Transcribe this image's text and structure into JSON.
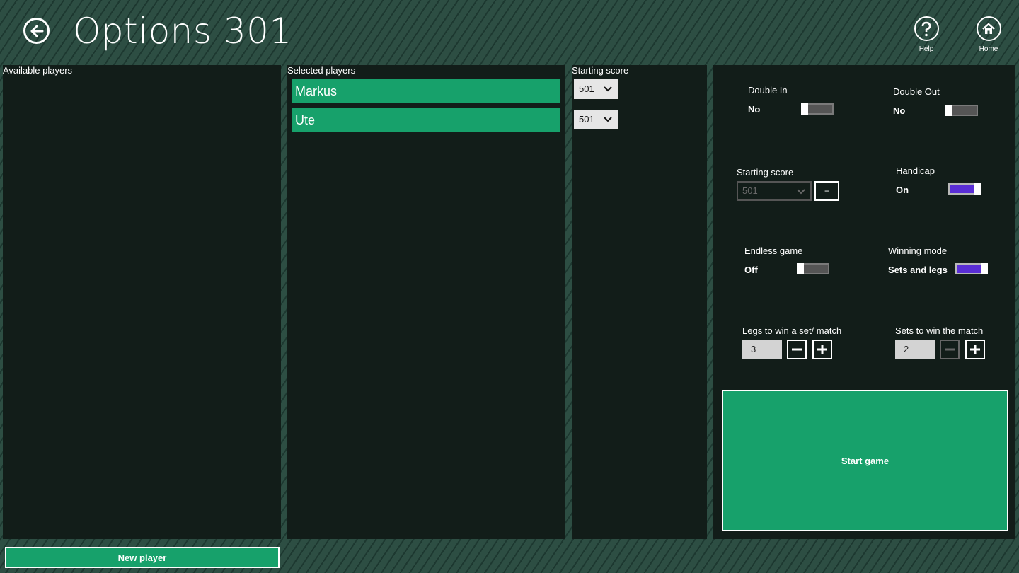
{
  "header": {
    "title": "Options 301",
    "back_icon": "arrow-left-icon",
    "help_label": "Help",
    "home_label": "Home"
  },
  "available_players": {
    "label": "Available players",
    "items": []
  },
  "selected_players": {
    "label": "Selected players",
    "items": [
      "Markus",
      "Ute"
    ]
  },
  "starting_scores": {
    "label": "Starting score",
    "values": [
      "501",
      "501"
    ]
  },
  "options": {
    "double_in": {
      "label": "Double In",
      "value": "No",
      "state": "off"
    },
    "double_out": {
      "label": "Double Out",
      "value": "No",
      "state": "off"
    },
    "starting_score": {
      "label": "Starting score",
      "value": "501",
      "add_label": "+"
    },
    "handicap": {
      "label": "Handicap",
      "value": "On",
      "state": "on"
    },
    "endless_game": {
      "label": "Endless game",
      "value": "Off",
      "state": "off"
    },
    "winning_mode": {
      "label": "Winning mode",
      "value": "Sets and legs",
      "state": "on"
    },
    "legs_to_win": {
      "label": "Legs to win a set/ match",
      "value": "3"
    },
    "sets_to_win": {
      "label": "Sets to win the match",
      "value": "2"
    }
  },
  "actions": {
    "start_game": "Start game",
    "new_player": "New player"
  },
  "colors": {
    "accent_green": "#17a16b",
    "toggle_on": "#5a2ed6",
    "panel_bg": "#121d19"
  }
}
